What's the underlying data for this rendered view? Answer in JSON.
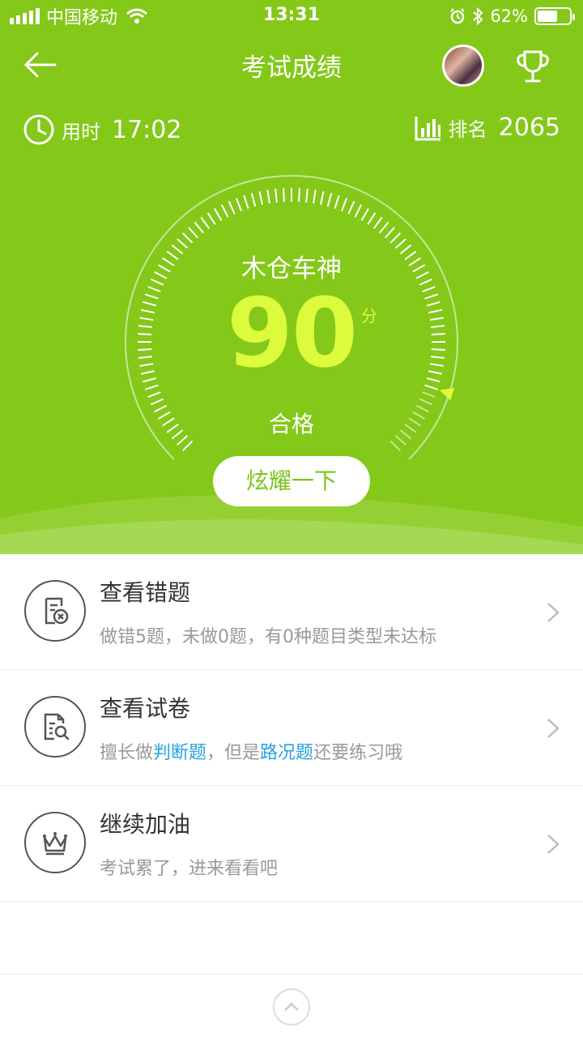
{
  "status_bar": {
    "carrier": "中国移动",
    "time": "13:31",
    "battery": "62%",
    "battery_level": 0.62
  },
  "nav": {
    "title": "考试成绩",
    "back_icon": "arrow-left-icon",
    "trophy_icon": "trophy-icon"
  },
  "stats": {
    "time_label": "用时",
    "time_value": "17:02",
    "rank_label": "排名",
    "rank_value": "2065"
  },
  "result": {
    "level_title": "木仓车神",
    "score": "90",
    "score_unit": "分",
    "status": "合格",
    "score_fraction": 0.9,
    "share_label": "炫耀一下"
  },
  "list": [
    {
      "title": "查看错题",
      "subtitle": "做错5题，未做0题，有0种题目类型未达标",
      "icon": "wrong-answers-icon"
    },
    {
      "title": "查看试卷",
      "subtitle_parts": [
        "擅长做",
        "判断题",
        "，但是",
        "路况题",
        "还要练习哦"
      ],
      "icon": "review-paper-icon"
    },
    {
      "title": "继续加油",
      "subtitle": "考试累了，进来看看吧",
      "icon": "crown-icon"
    }
  ],
  "colors": {
    "hero_green": "#84c81a",
    "score_yellow": "#dcfb3c",
    "highlight_blue": "#2aa2e0"
  }
}
